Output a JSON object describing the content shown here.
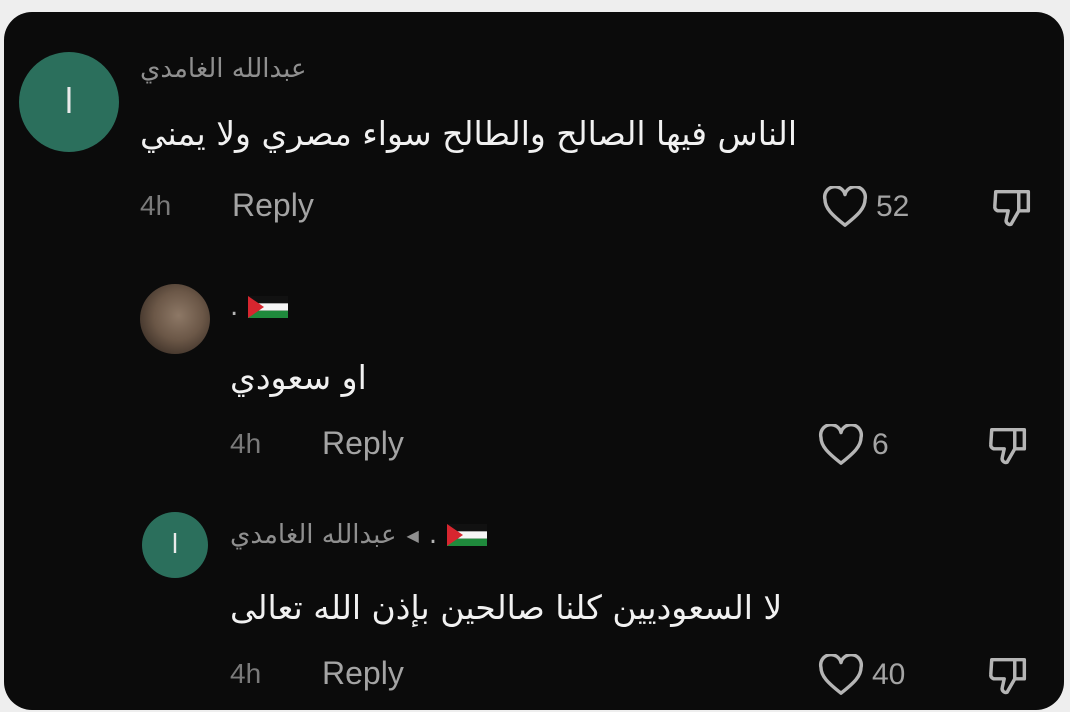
{
  "comments": [
    {
      "avatar_letter": "ا",
      "username": "عبدالله الغامدي",
      "text": "الناس فيها الصالح والطالح سواء مصري ولا يمني",
      "time": "4h",
      "reply_label": "Reply",
      "likes": "52"
    },
    {
      "username": ".",
      "text": "او سعودي",
      "time": "4h",
      "reply_label": "Reply",
      "likes": "6"
    },
    {
      "avatar_letter": "ا",
      "username": "عبدالله الغامدي",
      "reply_to": ".",
      "text": "لا السعوديين كلنا صالحين بإذن الله تعالى",
      "time": "4h",
      "reply_label": "Reply",
      "likes": "40"
    }
  ],
  "icons": {
    "like": "heart-outline-icon",
    "dislike": "thumbs-down-outline-icon",
    "flag": "palestine-flag-icon",
    "reply_arrow": "triangle-right-icon"
  },
  "colors": {
    "background": "#0b0b0b",
    "avatar_green": "#2b6f5c",
    "primary_text": "#f1f1f1",
    "secondary_text": "#8f8f8f"
  }
}
